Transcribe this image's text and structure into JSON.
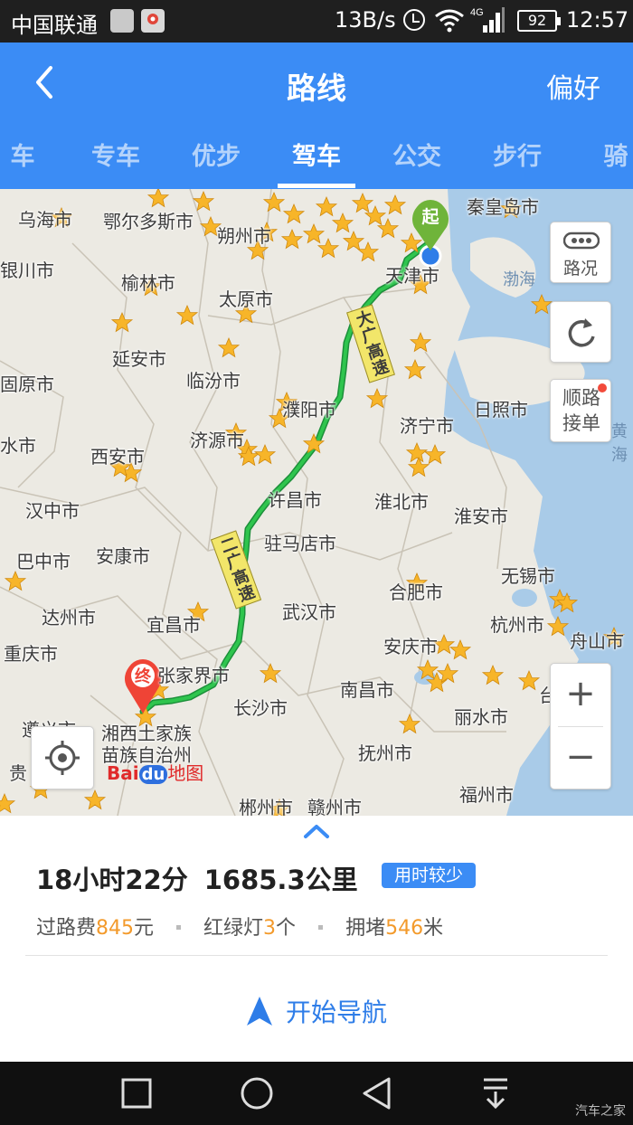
{
  "status_bar": {
    "carrier": "中国联通",
    "speed": "13B/s",
    "network": "4G",
    "battery": "92",
    "time": "12:57"
  },
  "header": {
    "title": "路线",
    "preference": "偏好",
    "tabs": [
      {
        "label": "车"
      },
      {
        "label": "专车"
      },
      {
        "label": "优步"
      },
      {
        "label": "驾车"
      },
      {
        "label": "公交"
      },
      {
        "label": "步行"
      },
      {
        "label": "骑"
      }
    ],
    "active_tab": "驾车"
  },
  "map": {
    "start_marker": "起",
    "end_marker": "终",
    "sea_label": "渤海",
    "highway_labels": [
      "大广高速",
      "二广高速"
    ],
    "cities": [
      "乌海市",
      "鄂尔多斯市",
      "朔州市",
      "秦皇岛市",
      "银川市",
      "榆林市",
      "太原市",
      "天津市",
      "延安市",
      "临汾市",
      "固原市",
      "濮阳市",
      "日照市",
      "济宁市",
      "济源市",
      "西安市",
      "许昌市",
      "淮北市",
      "汉中市",
      "淮安市",
      "巴中市",
      "安康市",
      "驻马店市",
      "无锡市",
      "合肥市",
      "达州市",
      "宜昌市",
      "武汉市",
      "杭州市",
      "舟山市",
      "安庆市",
      "重庆市",
      "张家界市",
      "长沙市",
      "南昌市",
      "丽水市",
      "湘西土家族苗族自治州",
      "抚州市",
      "福州市",
      "郴州市",
      "赣州市",
      "遵义市",
      "贵",
      "水市",
      "黄海",
      "台"
    ],
    "buttons": {
      "traffic": "路况",
      "refresh": "",
      "carpool": "顺路接单"
    },
    "logo": {
      "bai": "Bai",
      "du": "du",
      "map": "地图"
    }
  },
  "route": {
    "duration": "18小时22分",
    "distance": "1685.3公里",
    "badge": "用时较少",
    "toll_label": "过路费",
    "toll_value": "845",
    "toll_unit": "元",
    "lights_label": "红绿灯",
    "lights_value": "3",
    "lights_unit": "个",
    "jam_label": "拥堵",
    "jam_value": "546",
    "jam_unit": "米",
    "start_nav": "开始导航"
  },
  "watermark": "汽车之家",
  "colors": {
    "header_blue": "#3b8cf5",
    "route_green": "#22b14c",
    "highlight_orange": "#f39a2b",
    "start_green": "#6fb43a",
    "end_red": "#ef4436"
  }
}
